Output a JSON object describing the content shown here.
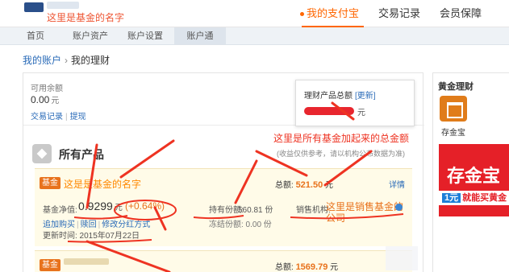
{
  "header": {
    "account_note": "这里是基金的名字",
    "nav": [
      {
        "label": "我的支付宝",
        "active": true
      },
      {
        "label": "交易记录",
        "active": false
      },
      {
        "label": "会员保障",
        "active": false
      }
    ]
  },
  "subnav": [
    {
      "label": "首页",
      "active": false
    },
    {
      "label": "账户资产",
      "active": false
    },
    {
      "label": "账户设置",
      "active": false
    },
    {
      "label": "账户通",
      "active": true
    }
  ],
  "breadcrumb": {
    "root": "我的账户",
    "separator": "›",
    "current": "我的理财"
  },
  "balance": {
    "label": "可用余额",
    "value": "0.00",
    "unit": "元",
    "links": [
      "交易记录",
      "提现"
    ]
  },
  "total_card": {
    "title": "理财产品总额",
    "update": "[更新]",
    "unit": "元"
  },
  "annotations": {
    "total": "这里是所有基金加起来的总金额",
    "fund_name": "这是是基金的名字",
    "org": "这里是销售基金的公司"
  },
  "products": {
    "title": "所有产品",
    "note": "(收益仅供参考，请以机构公布数据为准)"
  },
  "funds": [
    {
      "tag": "基金",
      "total_label": "总额:",
      "total_value": "521.50",
      "total_unit": "元",
      "detail": "详情",
      "nav_label": "基金净值:",
      "nav_value": "0.9299",
      "nav_unit": "元",
      "nav_change": "(+0.64%)",
      "share_label": "持有份额:",
      "share_value": "560.81 份",
      "frozen": "冻结份额: 0.00 份",
      "org_label": "销售机构:",
      "links": [
        "追加购买",
        "赎回",
        "修改分红方式"
      ],
      "update": "更新时间: 2015年07月22日"
    },
    {
      "tag": "基金",
      "total_label": "总额:",
      "total_value": "1569.79",
      "total_unit": "元"
    }
  ],
  "sidebar": {
    "title": "黄金理财",
    "product": "存金宝",
    "banner_title": "存金宝",
    "banner_one": "1元",
    "banner_sub": "就能买黄金"
  },
  "colors": {
    "accent": "#f60",
    "annotation": "#e32",
    "link": "#2a6bb8",
    "fund_bg": "#fffbe8"
  }
}
